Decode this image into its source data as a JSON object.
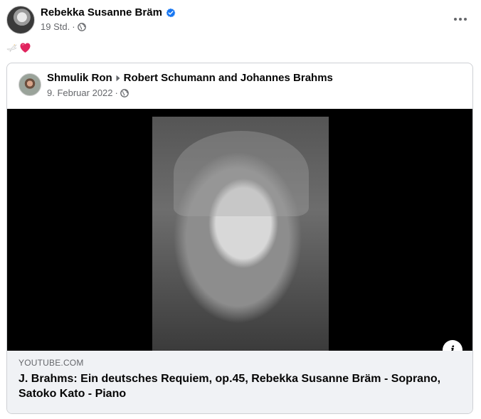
{
  "post": {
    "author": "Rebekka Susanne Bräm",
    "time": "19 Std.",
    "separator": "·",
    "privacy_icon": "globe-icon",
    "more_icon": "more-options-icon",
    "text_icons": [
      "dove-emoji",
      "red-heart-emoji"
    ]
  },
  "shared": {
    "author": "Shmulik Ron",
    "group": "Robert Schumann and Johannes Brahms",
    "date": "9. Februar 2022",
    "separator": "·",
    "privacy_icon": "globe-icon"
  },
  "link": {
    "source": "YOUTUBE.COM",
    "title": "J. Brahms: Ein deutsches Requiem, op.45, Rebekka Susanne Bräm - Soprano, Satoko Kato - Piano",
    "info_label": "i"
  },
  "colors": {
    "verified": "#1877f2",
    "secondary_text": "#65676b",
    "card_border": "#ced0d4",
    "link_bar_bg": "#f0f2f5",
    "heart": "#e0245e"
  }
}
